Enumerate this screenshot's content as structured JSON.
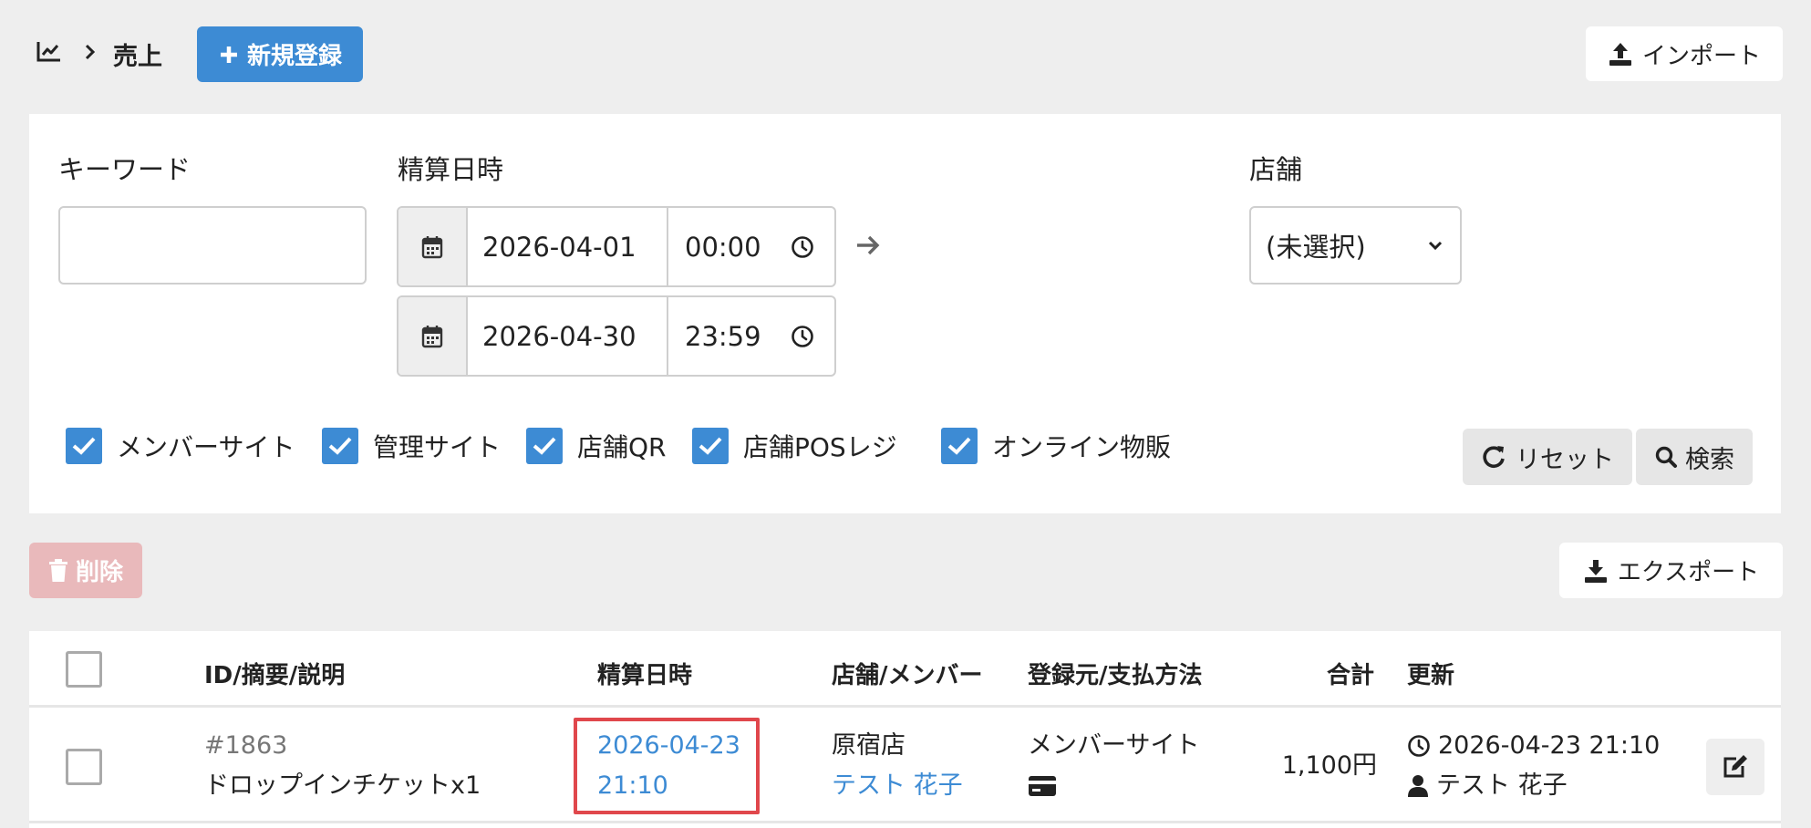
{
  "header": {
    "breadcrumb_icon": "chart-line-icon",
    "breadcrumb_sep_icon": "chevron-right-icon",
    "breadcrumb_label": "売上",
    "new_button_label": "新規登録",
    "import_button_label": "インポート"
  },
  "filters": {
    "keyword_label": "キーワード",
    "keyword_value": "",
    "datetime_label": "精算日時",
    "from_date": "2026-04-01",
    "from_time": "00:00",
    "to_date": "2026-04-30",
    "to_time": "23:59",
    "store_label": "店舗",
    "store_selected": "(未選択)",
    "sources": [
      {
        "label": "メンバーサイト",
        "checked": true
      },
      {
        "label": "管理サイト",
        "checked": true
      },
      {
        "label": "店舗QR",
        "checked": true
      },
      {
        "label": "店舗POSレジ",
        "checked": true
      },
      {
        "label": "オンライン物販",
        "checked": true
      }
    ],
    "reset_label": "リセット",
    "search_label": "検索"
  },
  "actions": {
    "delete_label": "削除",
    "export_label": "エクスポート"
  },
  "table": {
    "columns": [
      "ID/摘要/説明",
      "精算日時",
      "店舗/メンバー",
      "登録元/支払方法",
      "合計",
      "更新"
    ],
    "rows": [
      {
        "id": "#1863",
        "description": "ドロップインチケットx1",
        "date": "2026-04-23",
        "time": "21:10",
        "store": "原宿店",
        "member": "テスト 花子",
        "source": "メンバーサイト",
        "payment_icon": "credit-card-icon",
        "total": "1,100円",
        "updated_at": "2026-04-23 21:10",
        "updated_by": "テスト 花子"
      }
    ]
  },
  "colors": {
    "primary": "#3d8bd4",
    "danger_disabled": "#e9b9bb",
    "highlight": "#e0474c",
    "background": "#eeeeee"
  }
}
